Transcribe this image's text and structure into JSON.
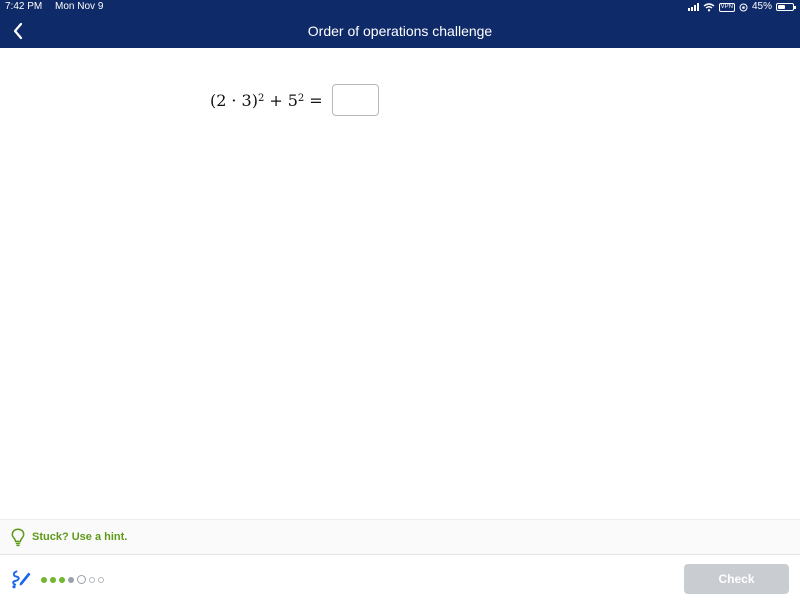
{
  "status_bar": {
    "time": "7:42 PM",
    "date": "Mon Nov 9",
    "vpn_label": "VPN",
    "battery_percent": "45%",
    "battery_level": 0.45
  },
  "nav": {
    "title": "Order of operations challenge",
    "back_icon": "chevron-left-icon"
  },
  "problem": {
    "open_paren": "(2",
    "dot": "·",
    "three_close": "3)",
    "exp1": "2",
    "plus": "+",
    "five": "5",
    "exp2": "2",
    "equals": "=",
    "answer_value": ""
  },
  "hint": {
    "text": "Stuck? Use a hint.",
    "icon": "lightbulb-icon"
  },
  "footer": {
    "scratchpad_icon": "scratchpad-pencil-icon",
    "progress": [
      "done",
      "done",
      "done",
      "pending",
      "current",
      "future",
      "future"
    ],
    "check_label": "Check"
  },
  "colors": {
    "header": "#0f2a68",
    "hint_green": "#5f9a19",
    "progress_green": "#71b730",
    "check_disabled": "#c9ccd0",
    "scratchpad_blue": "#1865f2"
  }
}
